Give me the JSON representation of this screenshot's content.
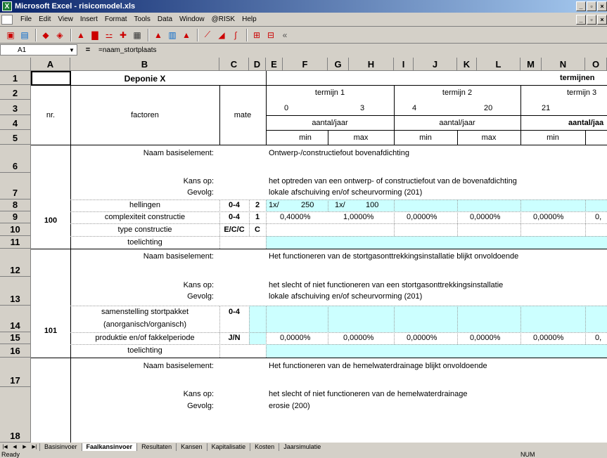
{
  "window": {
    "title": "Microsoft Excel - risicomodel.xls",
    "app_icon": "excel-icon"
  },
  "menu": [
    "File",
    "Edit",
    "View",
    "Insert",
    "Format",
    "Tools",
    "Data",
    "Window",
    "@RISK",
    "Help"
  ],
  "formula_bar": {
    "name_box": "A1",
    "equals": "=",
    "formula": "=naam_stortplaats"
  },
  "columns": [
    "A",
    "B",
    "C",
    "D",
    "E",
    "F",
    "G",
    "H",
    "I",
    "J",
    "K",
    "L",
    "M",
    "N",
    "O"
  ],
  "rows": [
    "1",
    "2",
    "3",
    "4",
    "5",
    "6",
    "7",
    "8",
    "9",
    "10",
    "11",
    "12",
    "13",
    "14",
    "15",
    "16",
    "17",
    "18"
  ],
  "header": {
    "title": "Deponie X",
    "termijnen": "termijnen",
    "nr": "nr.",
    "factoren": "factoren",
    "mate": "mate",
    "termijn1": "termijn 1",
    "t1_from": "0",
    "t1_to": "3",
    "termijn2": "termijn 2",
    "t2_from": "4",
    "t2_to": "20",
    "termijn3": "termijn 3",
    "t3_from": "21",
    "aantal1": "aantal/jaar",
    "aantal2": "aantal/jaar",
    "aantal3": "aantal/jaa",
    "min": "min",
    "max": "max"
  },
  "block100": {
    "nr": "100",
    "naam_label": "Naam basiselement:",
    "naam": "Ontwerp-/constructiefout bovenafdichting",
    "kans_label": "Kans op:",
    "kans": "het optreden van een ontwerp- of constructiefout van de bovenafdichting",
    "gevolg_label": "Gevolg:",
    "gevolg": "lokale afschuiving en/of scheurvorming (201)",
    "r8": {
      "factor": "hellingen",
      "mate": "0-4",
      "d": "2",
      "e": "1x/",
      "f": "250",
      "g": "1x/",
      "h": "100"
    },
    "r9": {
      "factor": "complexiteit constructie",
      "mate": "0-4",
      "d": "1",
      "f": "0,4000%",
      "h": "1,0000%",
      "j": "0,0000%",
      "l": "0,0000%",
      "n": "0,0000%",
      "o": "0,"
    },
    "r10": {
      "factor": "type constructie",
      "mate": "E/C/C",
      "d": "C"
    },
    "r11": {
      "factor": "toelichting"
    }
  },
  "block101": {
    "nr": "101",
    "naam_label": "Naam basiselement:",
    "naam": "Het functioneren van de stortgasonttrekkingsinstallatie blijkt onvoldoende",
    "kans_label": "Kans op:",
    "kans": "het slecht of niet functioneren van een stortgasonttrekkingsinstallatie",
    "gevolg_label": "Gevolg:",
    "gevolg": "lokale afschuiving en/of scheurvorming (201)",
    "r14": {
      "factor1": "samenstelling stortpakket",
      "factor2": "(anorganisch/organisch)",
      "mate": "0-4"
    },
    "r15": {
      "factor": "produktie en/of fakkelperiode",
      "mate": "J/N",
      "f": "0,0000%",
      "h": "0,0000%",
      "j": "0,0000%",
      "l": "0,0000%",
      "n": "0,0000%",
      "o": "0,"
    },
    "r16": {
      "factor": "toelichting"
    }
  },
  "block17": {
    "naam_label": "Naam basiselement:",
    "naam": "Het functioneren van de hemelwaterdrainage blijkt onvoldoende",
    "kans_label": "Kans op:",
    "kans": "het slecht of niet functioneren van de hemelwaterdrainage",
    "gevolg_label": "Gevolg:",
    "gevolg": "erosie (200)"
  },
  "sheets": [
    {
      "label": "Basisinvoer",
      "active": false
    },
    {
      "label": "Faalkansinvoer",
      "active": true
    },
    {
      "label": "Resultaten",
      "active": false
    },
    {
      "label": "Kansen",
      "active": false
    },
    {
      "label": "Kapitalisatie",
      "active": false
    },
    {
      "label": "Kosten",
      "active": false
    },
    {
      "label": "Jaarsimulatie",
      "active": false
    }
  ],
  "status": {
    "left": "Ready",
    "num": "NUM"
  }
}
